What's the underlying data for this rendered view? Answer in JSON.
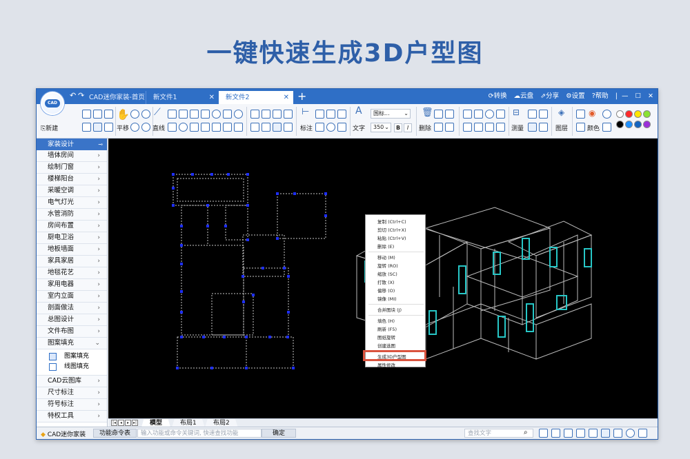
{
  "hero_title": "一键快速生成3D户型图",
  "window": {
    "tabs": [
      {
        "label": "CAD迷你家装-首页"
      },
      {
        "label": "新文件1"
      },
      {
        "label": "新文件2"
      }
    ],
    "title_actions": [
      "转换",
      "云盘",
      "分享",
      "设置",
      "帮助"
    ],
    "logo_text": "CAD"
  },
  "ribbon": {
    "new_label": "新建",
    "pan_label": "平移",
    "line_label": "直线",
    "dim_label": "标注",
    "text_label": "文字",
    "font_value": "国标...",
    "size_value": "350",
    "bold_label": "B",
    "italic_label": "I",
    "delete_label": "删除",
    "measure_label": "测量",
    "layer_label": "图层",
    "color_label": "颜色",
    "swatches": [
      "#ffffff",
      "#ff2a2a",
      "#ffe600",
      "#8ae234",
      "#000000",
      "#1e90ff",
      "#1565c0",
      "#9b30d9"
    ]
  },
  "sidebar": {
    "header": "家装设计",
    "items": [
      "墙体房间",
      "绘制门窗",
      "楼梯阳台",
      "采暖空调",
      "电气灯光",
      "水管消防",
      "房间布置",
      "厨电卫浴",
      "地板墙面",
      "家具家居",
      "地毯花艺",
      "家用电器",
      "室内立面",
      "剖面做法",
      "总图设计",
      "文件布图",
      "图案填充"
    ],
    "subitems": [
      "图案填充",
      "线图填充"
    ],
    "items_after": [
      "CAD云图库",
      "尺寸标注",
      "符号标注",
      "特权工具"
    ]
  },
  "context_menu": {
    "items": [
      "复制 (Ctrl+C)",
      "剪切 (Ctrl+X)",
      "粘贴 (Ctrl+V)",
      "删除 (E)",
      "移动 (M)",
      "旋转 (RO)",
      "缩放 (SC)",
      "打散 (X)",
      "偏移 (O)",
      "镜像 (MI)",
      "合并图块 (J)",
      "填色 (H)",
      "刷新 (F5)",
      "图纸旋转",
      "创建选图",
      "生成3D户型图",
      "属性修改"
    ],
    "highlighted": "生成3D户型图"
  },
  "layout_tabs": [
    "模型",
    "布局1",
    "布局2"
  ],
  "status": {
    "app": "CAD迷你家装",
    "cmd_label": "功能命令表",
    "cmd_placeholder": "输入功能或命令关键词, 快速查找功能",
    "ok_label": "确定",
    "find_placeholder": "查找文字"
  }
}
